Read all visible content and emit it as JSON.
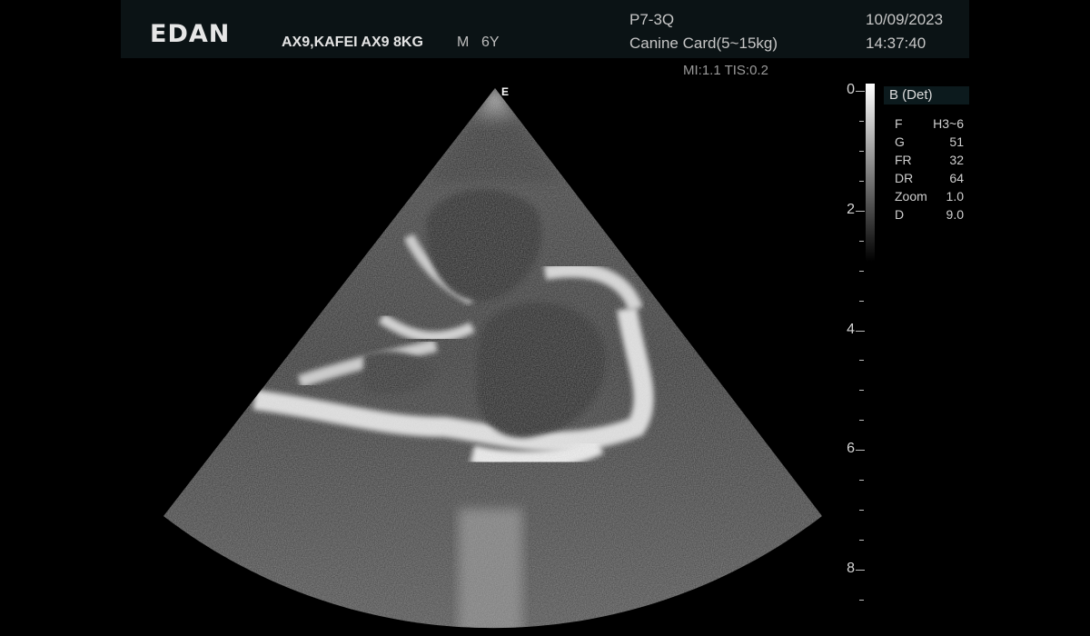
{
  "header": {
    "logo": "EDAN",
    "patient": "AX9,KAFEI AX9 8KG",
    "sex": "M",
    "age": "6Y",
    "probe": "P7-3Q",
    "preset": "Canine Card(5~15kg)",
    "date": "10/09/2023",
    "time": "14:37:40"
  },
  "safety": {
    "text": "MI:1.1 TIS:0.2"
  },
  "orientation_marker": "E",
  "mode": "B (Det)",
  "params": [
    {
      "key": "F",
      "value": "H3~6"
    },
    {
      "key": "G",
      "value": "51"
    },
    {
      "key": "FR",
      "value": "32"
    },
    {
      "key": "DR",
      "value": "64"
    },
    {
      "key": "Zoom",
      "value": "1.0"
    },
    {
      "key": "D",
      "value": "9.0"
    }
  ],
  "depth_scale": {
    "labels": [
      "0",
      "2",
      "4",
      "6",
      "8"
    ],
    "max_depth": 9.0,
    "unit_steps": 0.5
  },
  "colors": {
    "header_bg": "#0b1315",
    "tissue_bright": "#e8e8e8",
    "background": "#000000"
  }
}
